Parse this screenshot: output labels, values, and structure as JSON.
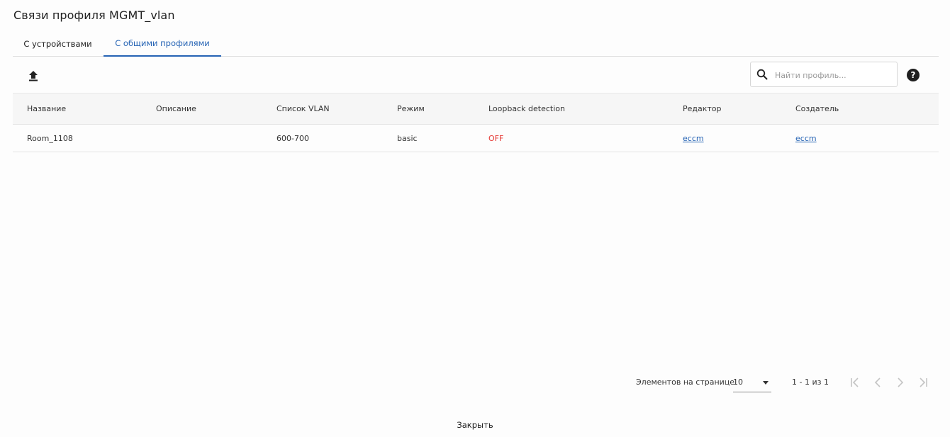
{
  "dialog": {
    "title": "Связи профиля MGMT_vlan"
  },
  "tabs": [
    {
      "label": "С устройствами",
      "active": false
    },
    {
      "label": "С общими профилями",
      "active": true
    }
  ],
  "toolbar": {
    "upload_icon": "upload-icon",
    "search": {
      "placeholder": "Найти профиль...",
      "value": ""
    },
    "help_icon": "help-icon",
    "help_label": "?"
  },
  "table": {
    "columns": [
      "Название",
      "Описание",
      "Список VLAN",
      "Режим",
      "Loopback detection",
      "Редактор",
      "Создатель"
    ],
    "rows": [
      {
        "name": "Room_1108",
        "description": "",
        "vlan_list": "600-700",
        "mode": "basic",
        "loopback": "OFF",
        "editor": "eccm",
        "creator": "eccm"
      }
    ]
  },
  "paginator": {
    "items_per_page_label": "Элементов на странице",
    "page_size": "10",
    "range": "1 - 1 из 1"
  },
  "footer": {
    "close_label": "Закрыть"
  },
  "colors": {
    "accent": "#2563b4",
    "status_off": "#e53935"
  }
}
